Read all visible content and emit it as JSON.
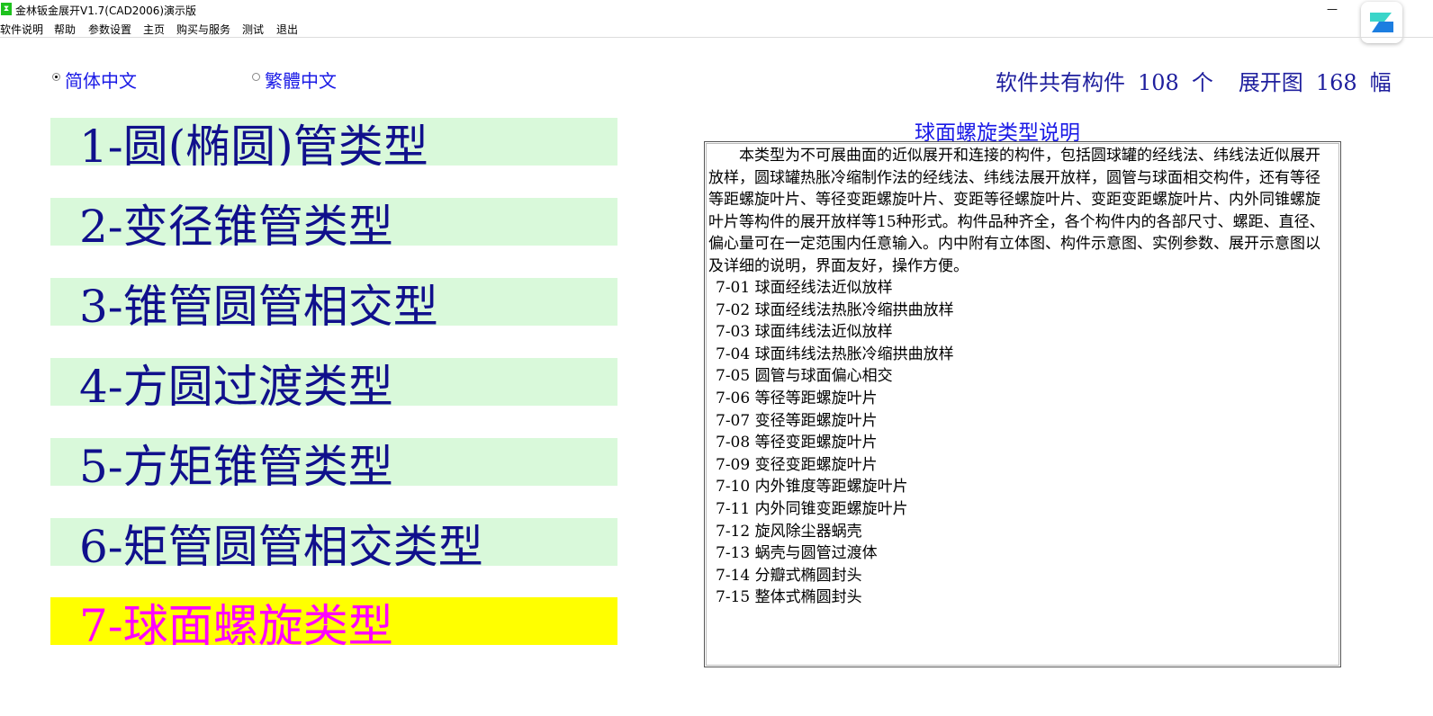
{
  "window": {
    "title": "金林钣金展开V1.7(CAD2006)演示版",
    "min_glyph": "—",
    "max_glyph": "❐"
  },
  "menu": [
    "软件说明",
    "帮助",
    "参数设置",
    "主页",
    "购买与服务",
    "测试",
    "退出"
  ],
  "language": {
    "simplified": "简体中文",
    "traditional": "繁體中文",
    "selected": "simplified"
  },
  "counts": {
    "parts_label": "软件共有构件",
    "parts_value": "108",
    "parts_unit": "个",
    "drawings_label": "展开图",
    "drawings_value": "168",
    "drawings_unit": "幅"
  },
  "categories": [
    "1-圆(椭圆)管类型",
    "2-变径锥管类型",
    "3-锥管圆管相交型",
    "4-方圆过渡类型",
    "5-方矩锥管类型",
    "6-矩管圆管相交类型",
    "7-球面螺旋类型"
  ],
  "selected_category": 6,
  "colors": {
    "category_bg": "#d9f9da",
    "category_text": "#10108c",
    "selected_bg": "#ffff00",
    "selected_text": "#ff00ff",
    "title_blue": "#1a1ae6"
  },
  "description": {
    "title": "球面螺旋类型说明",
    "intro": "本类型为不可展曲面的近似展开和连接的构件，包括圆球罐的经线法、纬线法近似展开放样，圆球罐热胀冷缩制作法的经线法、纬线法展开放样，圆管与球面相交构件，还有等径等距螺旋叶片、等径变距螺旋叶片、变距等径螺旋叶片、变距变距螺旋叶片、内外同锥螺旋叶片等构件的展开放样等15种形式。构件品种齐全，各个构件内的各部尺寸、螺距、直径、偏心量可在一定范围内任意输入。内中附有立体图、构件示意图、实例参数、展开示意图以及详细的说明，界面友好，操作方便。",
    "items": [
      "7-01 球面经线法近似放样",
      "7-02 球面经线法热胀冷缩拱曲放样",
      "7-03 球面纬线法近似放样",
      "7-04 球面纬线法热胀冷缩拱曲放样",
      "7-05 圆管与球面偏心相交",
      "7-06 等径等距螺旋叶片",
      "7-07 变径等距螺旋叶片",
      "7-08 等径变距螺旋叶片",
      "7-09 变径变距螺旋叶片",
      "7-10 内外锥度等距螺旋叶片",
      "7-11 内外同锥变距螺旋叶片",
      "7-12 旋风除尘器蜗壳",
      "7-13 蜗壳与圆管过渡体",
      "7-14 分瓣式椭圆封头",
      "7-15 整体式椭圆封头"
    ]
  }
}
